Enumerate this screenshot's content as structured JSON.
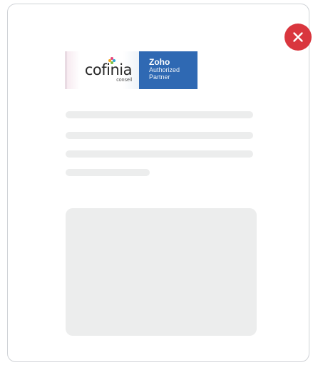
{
  "dialog": {
    "close_icon": "close-x-icon",
    "close_color": "#d9363e"
  },
  "logo": {
    "brand_name": "cofinia",
    "brand_sub": "conseil",
    "partner_title": "Zoho",
    "partner_line_1": "Authorized",
    "partner_line_2": "Partner",
    "partner_color": "#2f69b3"
  },
  "skeleton": {
    "color": "#eceded"
  }
}
